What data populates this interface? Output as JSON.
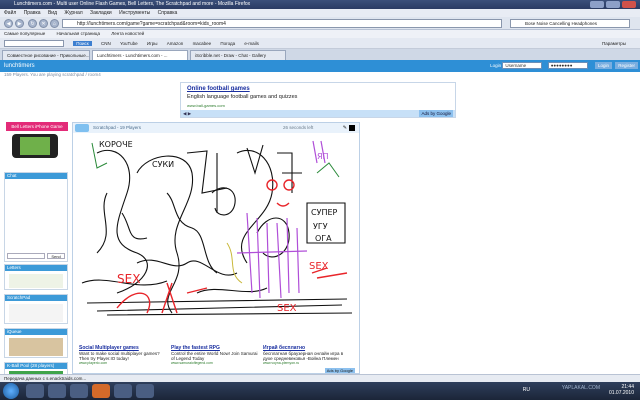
{
  "window": {
    "title": "Lunchtimers.com - Multi user Online Flash Games, Bell Letters, The Scratchpad and more - Mozilla Firefox"
  },
  "menubar": {
    "items": [
      "Файл",
      "Правка",
      "Вид",
      "Журнал",
      "Закладки",
      "Инструменты",
      "Справка"
    ]
  },
  "navbar": {
    "url": "http://lunchtimers.com/game?game=scratchpad&room=kids_room4",
    "search_value": "Bose Noise Cancelling Headphones"
  },
  "bookmarks": {
    "items": [
      "Самые популярные",
      "Начальная страница",
      "Лента новостей"
    ]
  },
  "toolbar2": {
    "search_placeholder": "",
    "search_button": "Поиск",
    "items": [
      "CNN",
      "YouTube",
      "Игры",
      "Amazon",
      "macabee",
      "Погода",
      "e-mails"
    ],
    "settings_label": "Параметры"
  },
  "tabs": [
    {
      "label": "Совместное рисование - Прикольные..."
    },
    {
      "label": "Lunchtimers - Lunchtimers.com - ..."
    },
    {
      "label": "iScribble.net - Draw - Chat - Gallery"
    }
  ],
  "site": {
    "logo_text": "lunchtimers",
    "login_label": "Login",
    "username_placeholder": "Username",
    "password_mask": "●●●●●●●●",
    "login_button": "Login",
    "register_button": "Register",
    "breadcrumb": "159 Players. You are playing scratchpad / room4"
  },
  "ad_top": {
    "headline": "Online football games",
    "description": "English language football games and quizzes",
    "url": "www.ball-games.com",
    "ads_by": "Ads by Google"
  },
  "left": {
    "play_button": "Bell Letters iPhone Game",
    "chat_header": "Chat",
    "send_button": "Send",
    "letters_header": "Letters",
    "scratchpad_header": "ScratchPad",
    "iqueue_header": "iQueue",
    "kball_header": "K-Ball Pool (28 players)"
  },
  "game": {
    "header": "Scratchpad - 19 Players",
    "countdown": "26 seconds left",
    "canvas_text": [
      "КОРОЧЕ",
      "ЯП",
      "SEX",
      "SEX",
      "СУПЕР",
      "УГУ",
      "ОГА",
      "СУКИ",
      "SEX"
    ]
  },
  "ads_bottom": [
    {
      "headline": "Social Multiplayer games",
      "text": "Want to make social multiplayer games? Then try Player.IO today!",
      "url": "www.playerio.com"
    },
    {
      "headline": "Play the fastest RPG",
      "text": "Control the entire World Now! Join Samurai of Legend Today",
      "url": "www.samuraioflegend.com"
    },
    {
      "headline": "Играй бесплатно",
      "text": "бесплатная браузерная онлайн игра в духе средневековья -Война Племен",
      "url": "www.voyna-plemyon.ru"
    }
  ],
  "ads_bottom_by": "Ads by Google",
  "statusbar": {
    "text": "Передача данных с s.enacktraids.com..."
  },
  "taskbar": {
    "lang": "RU",
    "time": "21:44",
    "date": "01.07.2010",
    "watermark": "YAPLAKAL.COM"
  },
  "colors": {
    "site_blue": "#2e8fd6",
    "pink_button": "#e32b78",
    "ink_red": "#e8252a",
    "ink_purple": "#b04fd8"
  }
}
